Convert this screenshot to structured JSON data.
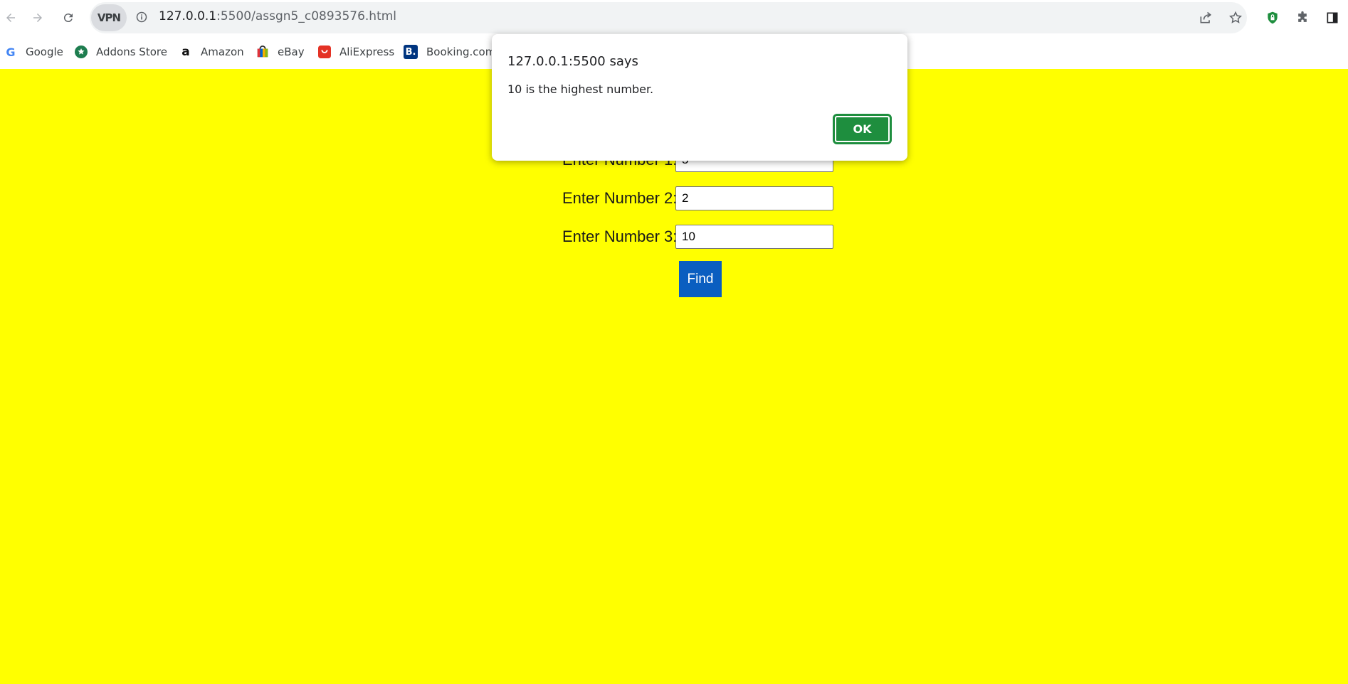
{
  "browser": {
    "url_host": "127.0.0.1",
    "url_rest": ":5500/assgn5_c0893576.html",
    "vpn_label": "VPN",
    "icons": [
      "back-icon",
      "forward-icon",
      "reload-icon",
      "info-icon",
      "share-icon",
      "star-icon",
      "shield-icon",
      "extensions-icon",
      "side-panel-icon"
    ]
  },
  "bookmarks": [
    {
      "label": "Google",
      "icon": "google-icon"
    },
    {
      "label": "Addons Store",
      "icon": "addons-store-icon"
    },
    {
      "label": "Amazon",
      "icon": "amazon-icon"
    },
    {
      "label": "eBay",
      "icon": "ebay-icon"
    },
    {
      "label": "AliExpress",
      "icon": "aliexpress-icon"
    },
    {
      "label": "Booking.com",
      "icon": "booking-icon"
    }
  ],
  "form": {
    "number1_label": "Enter Number 1:",
    "number1_value": "5",
    "number2_label": "Enter Number 2:",
    "number2_value": "2",
    "number3_label": "Enter Number 3:",
    "number3_value": "10",
    "find_label": "Find"
  },
  "dialog": {
    "title": "127.0.0.1:5500 says",
    "message": "10 is the highest number.",
    "ok_label": "OK"
  },
  "colors": {
    "page_background": "#ffff00",
    "find_button": "#0a5ec0",
    "ok_button": "#1e8e3e"
  }
}
